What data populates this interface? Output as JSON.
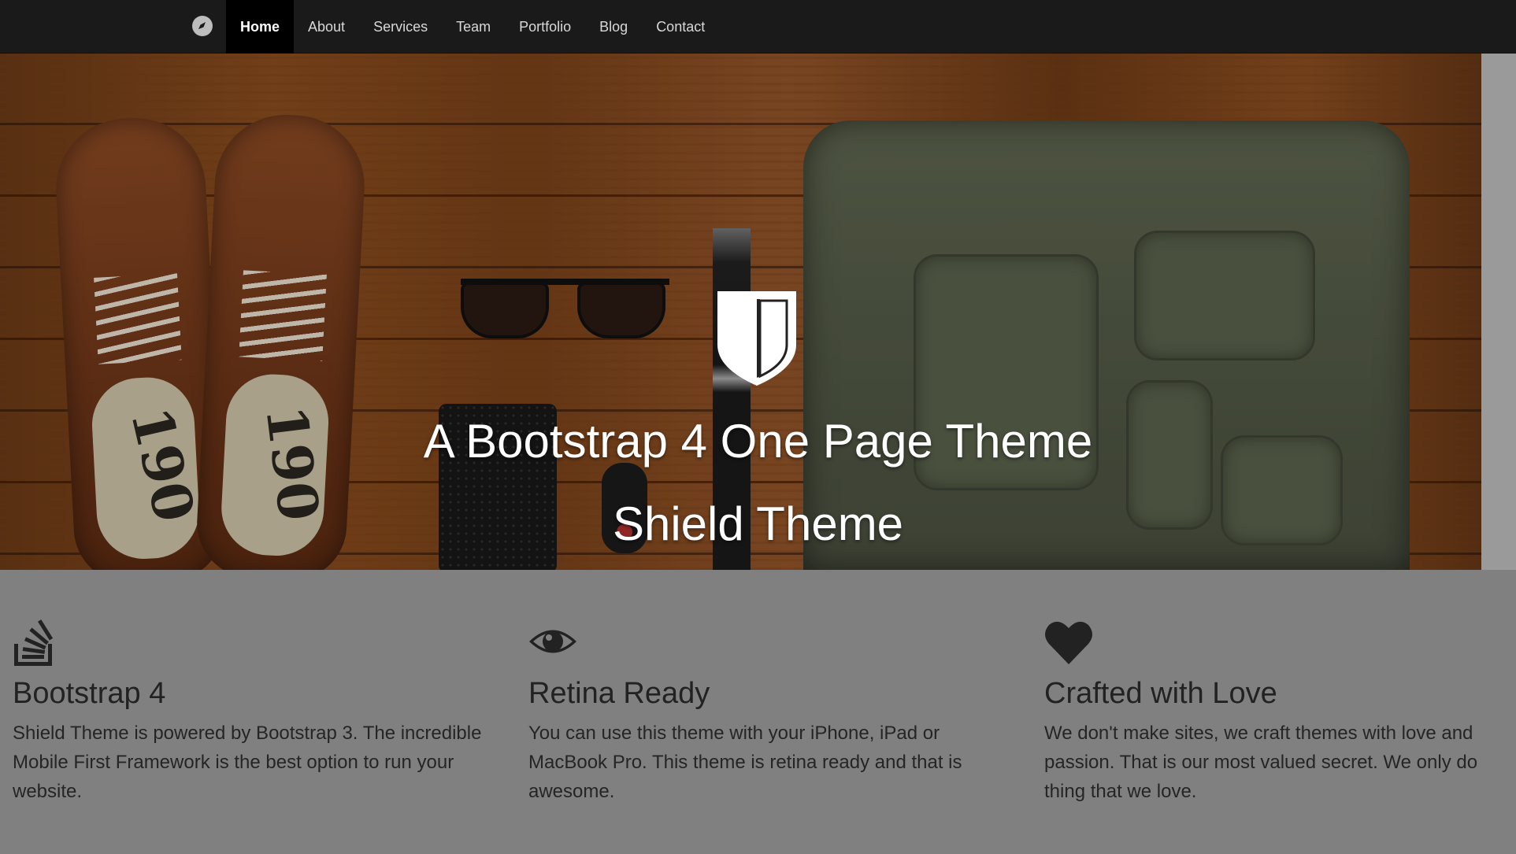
{
  "nav": {
    "brand_icon": "compass-icon",
    "items": [
      {
        "label": "Home",
        "active": true
      },
      {
        "label": "About",
        "active": false
      },
      {
        "label": "Services",
        "active": false
      },
      {
        "label": "Team",
        "active": false
      },
      {
        "label": "Portfolio",
        "active": false
      },
      {
        "label": "Blog",
        "active": false
      },
      {
        "label": "Contact",
        "active": false
      }
    ]
  },
  "hero": {
    "logo_icon": "shield-icon",
    "title": "A Bootstrap 4 One Page Theme",
    "subtitle": "Shield Theme",
    "shoe_number": "190"
  },
  "features": [
    {
      "icon": "stack-overflow-icon",
      "title": "Bootstrap 4",
      "text": "Shield Theme is powered by Bootstrap 3. The incredible Mobile First Framework is the best option to run your website."
    },
    {
      "icon": "eye-icon",
      "title": "Retina Ready",
      "text": "You can use this theme with your iPhone, iPad or MacBook Pro. This theme is retina ready and that is awesome."
    },
    {
      "icon": "heart-icon",
      "title": "Crafted with Love",
      "text": "We don't make sites, we craft themes with love and passion. That is our most valued secret. We only do thing that we love."
    }
  ],
  "colors": {
    "navbar_bg": "#1a1a1a",
    "nav_active_bg": "#000000",
    "features_bg": "#808080",
    "hero_text": "#ffffff"
  }
}
